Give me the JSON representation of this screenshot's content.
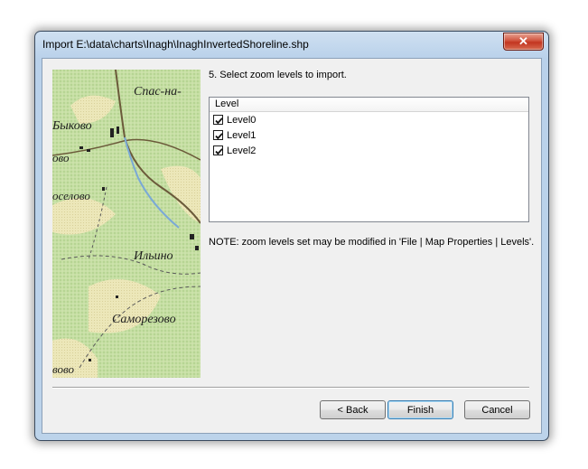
{
  "window": {
    "title": "Import E:\\data\\charts\\Inagh\\InaghInvertedShoreline.shp",
    "close_glyph": "✕"
  },
  "wizard": {
    "step_title": "5. Select zoom levels to import.",
    "list_header": "Level",
    "levels": [
      {
        "label": "Level0",
        "checked": true
      },
      {
        "label": "Level1",
        "checked": true
      },
      {
        "label": "Level2",
        "checked": true
      }
    ],
    "note": "NOTE: zoom levels set may be modified in 'File | Map Properties | Levels'."
  },
  "map_labels": {
    "spas": "Спас-на-",
    "bykovo": "Быково",
    "ovo": "ово",
    "oselovo": "оселово",
    "ilino": "Ильино",
    "samorezovo": "Саморезово",
    "vovo": "вово"
  },
  "buttons": {
    "back": "< Back",
    "finish": "Finish",
    "cancel": "Cancel"
  }
}
